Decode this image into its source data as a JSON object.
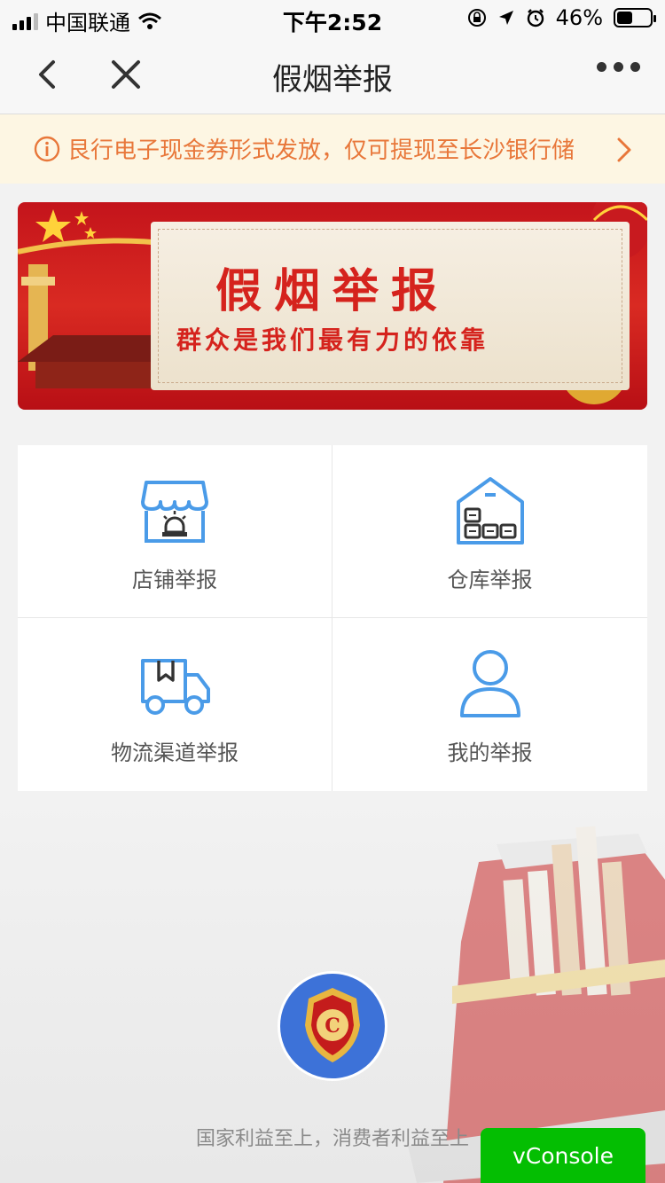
{
  "status": {
    "carrier": "中国联通",
    "time": "下午2:52",
    "battery_percent": "46%",
    "battery_level": 0.46
  },
  "nav": {
    "title": "假烟举报",
    "back_icon": "chevron-left-icon",
    "close_icon": "close-icon",
    "more_icon": "more-icon"
  },
  "notice": {
    "text": "艮行电子现金券形式发放，仅可提现至长沙银行储"
  },
  "banner": {
    "title": "假烟举报",
    "subtitle": "群众是我们最有力的依靠"
  },
  "grid": {
    "items": [
      {
        "label": "店铺举报",
        "icon": "store-icon"
      },
      {
        "label": "仓库举报",
        "icon": "warehouse-icon"
      },
      {
        "label": "物流渠道举报",
        "icon": "truck-icon"
      },
      {
        "label": "我的举报",
        "icon": "user-icon"
      }
    ]
  },
  "footer": {
    "slogan": "国家利益至上，消费者利益至上"
  },
  "vconsole": {
    "label": "vConsole"
  },
  "colors": {
    "accent_blue": "#4a9be8",
    "notice_orange": "#e8773a",
    "banner_red": "#d5231d",
    "vconsole_green": "#04be02"
  }
}
